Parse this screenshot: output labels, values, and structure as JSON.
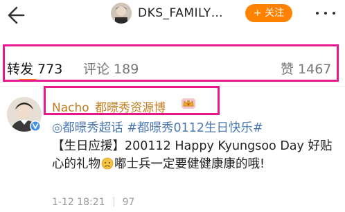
{
  "header": {
    "title": "DKS_FAMILY…",
    "follow_label": "+ 关注"
  },
  "tabs": {
    "repost": "转发 773",
    "comment": "评论 189",
    "like": "赞 1467"
  },
  "post": {
    "username": "Nacho_都暻秀资源博",
    "tag_1": "◎都暻秀超话",
    "tag_2": "#都暻秀0112生日快乐#",
    "text_1": "【生日应援】200112 Happy Kyungsoo Day 好贴心的礼物",
    "text_2": "嘟士兵一定要健健康康的哦!",
    "time": "1-12 18:21",
    "count": "97"
  },
  "colors": {
    "accent": "#ff8200",
    "highlight": "#e8178c",
    "username": "#c17d22",
    "link": "#4a77b0"
  }
}
